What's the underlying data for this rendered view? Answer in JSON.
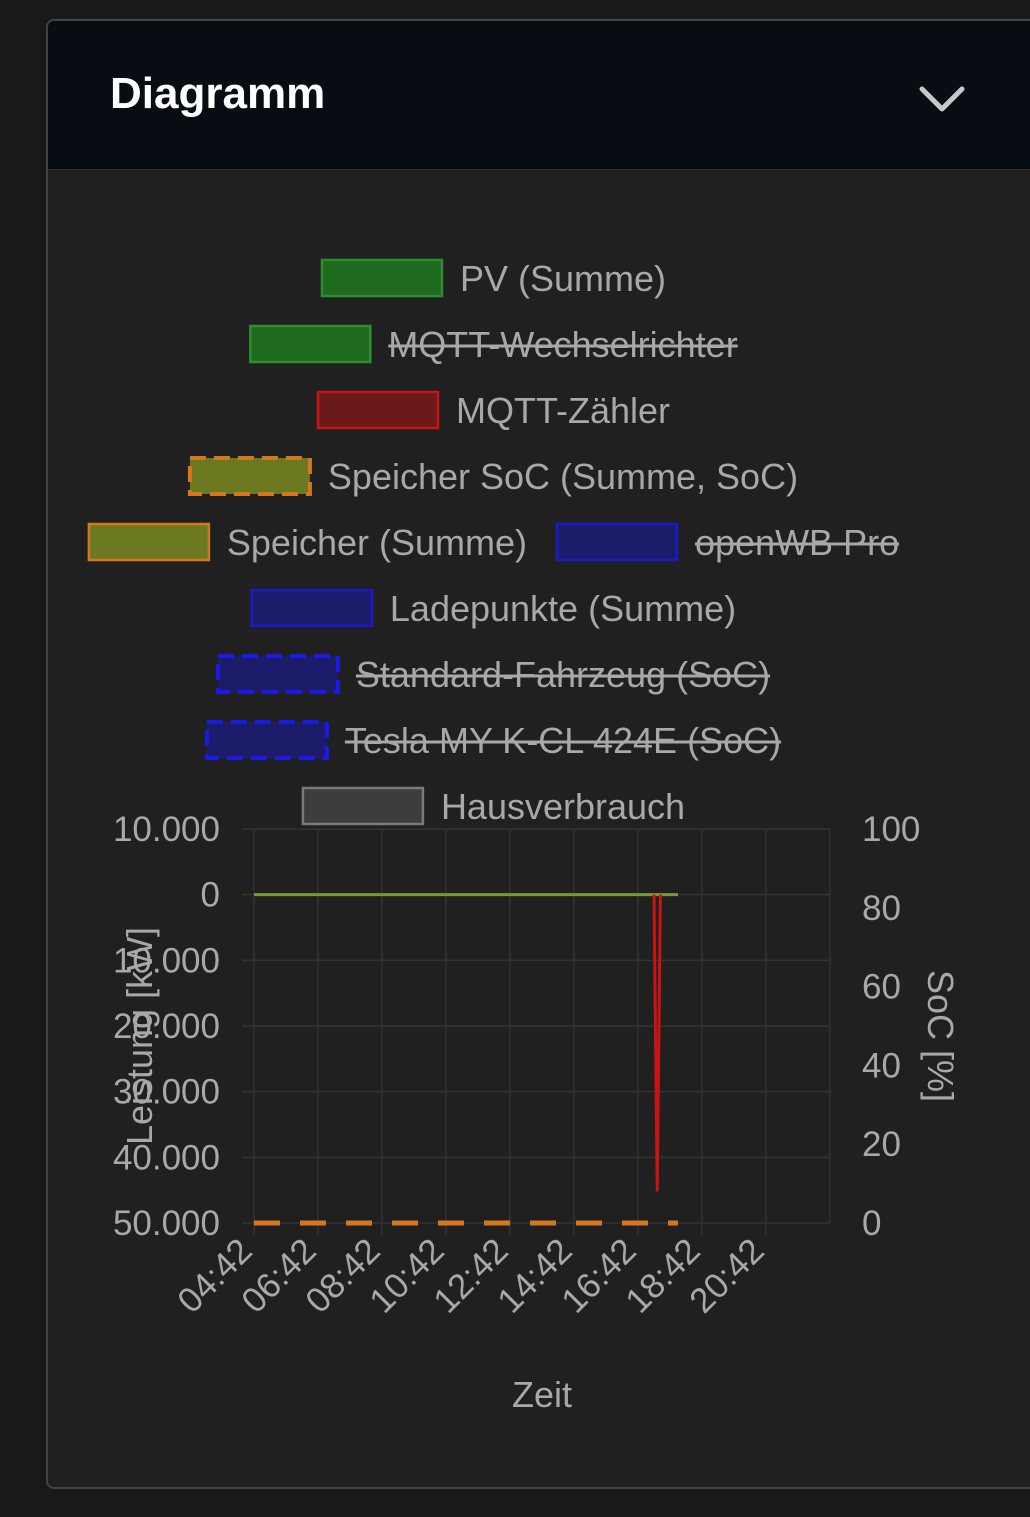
{
  "card": {
    "title": "Diagramm",
    "collapse_icon": "chevron-down-icon"
  },
  "chart_data": {
    "type": "line",
    "legend": [
      {
        "label": "PV (Summe)",
        "color": "#2e8b2e",
        "fill": "#1e6a1e",
        "hidden": false,
        "dashed": false
      },
      {
        "label": "MQTT-Wechselrichter",
        "color": "#2e8b2e",
        "fill": "#1e6a1e",
        "hidden": true,
        "dashed": false
      },
      {
        "label": "MQTT-Zähler",
        "color": "#c81414",
        "fill": "#6b1a1a",
        "hidden": false,
        "dashed": false
      },
      {
        "label": "Speicher SoC (Summe, SoC)",
        "color": "#d4781e",
        "fill": "#6b7a20",
        "hidden": false,
        "dashed": true
      },
      {
        "label": "Speicher (Summe)",
        "color": "#d4781e",
        "fill": "#6b7a20",
        "hidden": false,
        "dashed": false
      },
      {
        "label": "openWB Pro",
        "color": "#1a1ac8",
        "fill": "#1c1c6b",
        "hidden": true,
        "dashed": false
      },
      {
        "label": "Ladepunkte (Summe)",
        "color": "#1a1ac8",
        "fill": "#1c1c6b",
        "hidden": false,
        "dashed": false
      },
      {
        "label": "Standard-Fahrzeug (SoC)",
        "color": "#1a1ae6",
        "fill": "#1c1c6b",
        "hidden": true,
        "dashed": true
      },
      {
        "label": "Tesla MY K-CL 424E (SoC)",
        "color": "#1a1ae6",
        "fill": "#1c1c6b",
        "hidden": true,
        "dashed": true
      },
      {
        "label": "Hausverbrauch",
        "color": "#7a7a7a",
        "fill": "#3d3d3d",
        "hidden": false,
        "dashed": false
      }
    ],
    "x_ticks": [
      "04:42",
      "06:42",
      "08:42",
      "10:42",
      "12:42",
      "14:42",
      "16:42",
      "18:42",
      "20:42"
    ],
    "xlabel": "Zeit",
    "y_left": {
      "label": "Leistung [kW]",
      "ticks": [
        "10.000",
        "0",
        "10.000",
        "20.000",
        "30.000",
        "40.000",
        "50.000"
      ],
      "tick_values": [
        10000,
        0,
        -10000,
        -20000,
        -30000,
        -40000,
        -50000
      ],
      "range": [
        -50000,
        10000
      ]
    },
    "y_right": {
      "label": "SoC [%]",
      "ticks": [
        "100",
        "80",
        "60",
        "40",
        "20",
        "0"
      ],
      "tick_values": [
        100,
        80,
        60,
        40,
        20,
        0
      ],
      "range": [
        0,
        100
      ]
    },
    "x_range_hours": [
      4.7,
      22.7
    ],
    "series": [
      {
        "name": "PV (Summe)",
        "axis": "left",
        "color": "#7a9a3a",
        "x": [
          4.7,
          17.95
        ],
        "y": [
          0,
          0
        ]
      },
      {
        "name": "MQTT-Zähler",
        "axis": "left",
        "color": "#c81414",
        "x": [
          17.2,
          17.3,
          17.4
        ],
        "y": [
          0,
          -45000,
          0
        ]
      },
      {
        "name": "Speicher SoC (Summe, SoC)",
        "axis": "right",
        "color": "#d4781e",
        "dashed": true,
        "x": [
          4.7,
          17.95
        ],
        "y": [
          0,
          0
        ]
      }
    ],
    "grid": true
  }
}
